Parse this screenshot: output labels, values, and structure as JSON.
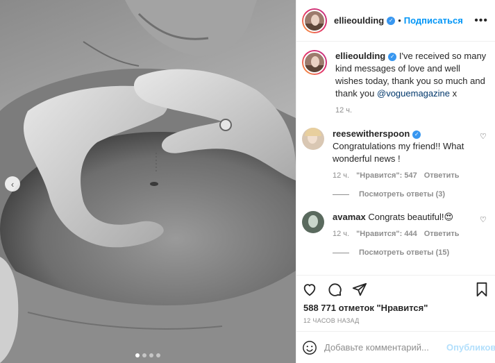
{
  "post": {
    "author": "ellieoulding",
    "follow_label": "Подписаться",
    "more_label": "•••",
    "photo_dots_count": 4,
    "active_dot": 0
  },
  "caption": {
    "author": "ellieoulding",
    "text_before": "I've received so many kind messages of love and well wishes today, thank you so much and thank you ",
    "mention": "@voguemagazine",
    "text_after": " x",
    "time": "12 ч."
  },
  "comments": [
    {
      "author": "reesewitherspoon",
      "text": "Congratulations my friend!! What wonderful news !",
      "time": "12 ч.",
      "likes": "\"Нравится\": 547",
      "reply_label": "Ответить",
      "view_replies": "Посмотреть ответы (3)"
    },
    {
      "author": "avamax",
      "text": "Congrats beautiful!",
      "emoji": "😍",
      "time": "12 ч.",
      "likes": "\"Нравится\": 444",
      "reply_label": "Ответить",
      "view_replies": "Посмотреть ответы (15)"
    }
  ],
  "stats": {
    "likes": "588 771 отметок \"Нравится\"",
    "time": "12 ЧАСОВ НАЗАД"
  },
  "composer": {
    "placeholder": "Добавьте комментарий...",
    "post_label": "Опубликовать"
  },
  "colors": {
    "link": "#0095f6",
    "verified": "#3897f0",
    "muted": "#8e8e8e"
  },
  "icons": [
    "chevron-left-icon",
    "heart-icon",
    "comment-icon",
    "share-icon",
    "bookmark-icon",
    "smiley-icon",
    "verified-icon",
    "more-icon"
  ]
}
